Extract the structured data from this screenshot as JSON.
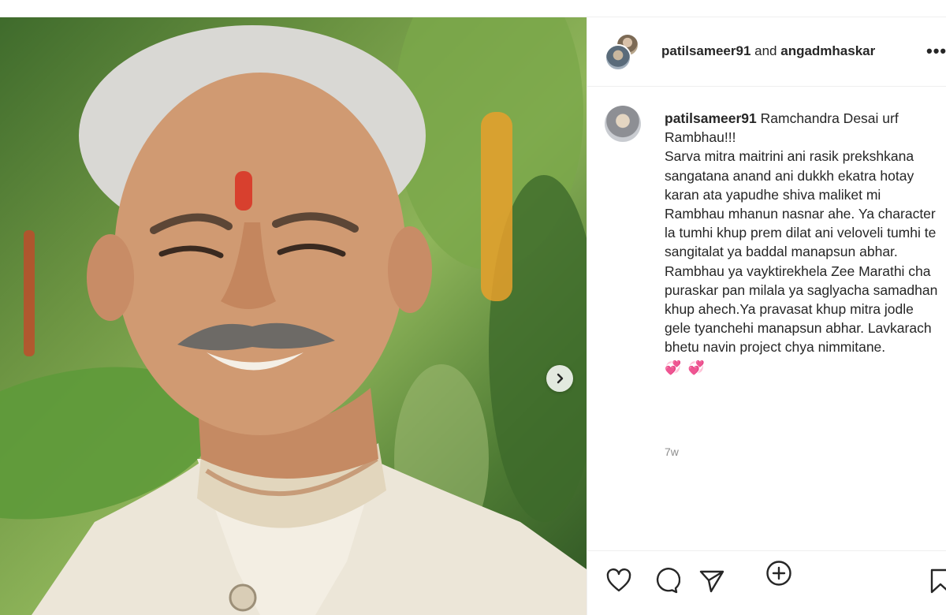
{
  "post": {
    "photo_alt": "",
    "header": {
      "user1": "patilsameer91",
      "joiner": "and",
      "user2": "angadmhaskar"
    },
    "caption": {
      "username": "patilsameer91",
      "text": "Ramchandra Desai urf Rambhau!!!\nSarva mitra maitrini ani rasik prekshkana sangatana anand ani dukkh ekatra hotay karan ata yapudhe shiva maliket mi Rambhau mhanun nasnar ahe. Ya character la tumhi khup prem dilat ani veloveli tumhi te sangitalat ya baddal manapsun abhar. Rambhau ya vayktirekhela Zee Marathi cha puraskar pan milala ya saglyacha samadhan khup ahech.Ya pravasat khup mitra jodle gele tyanchehi manapsun abhar. Lavkarach bhetu navin project chya nimmitane.",
      "emoji": "💞 💞"
    },
    "timestamp": "7w"
  },
  "icons": {
    "more": "more-options-icon",
    "next": "chevron-right-icon",
    "add_comment": "plus-circle-icon",
    "like": "heart-icon",
    "comment": "comment-bubble-icon",
    "share": "paper-plane-icon",
    "save": "bookmark-icon"
  },
  "colors": {
    "text": "#262626",
    "muted": "#8e8e8e",
    "border": "#efefef",
    "heart_emoji": "#ff4f8b"
  }
}
